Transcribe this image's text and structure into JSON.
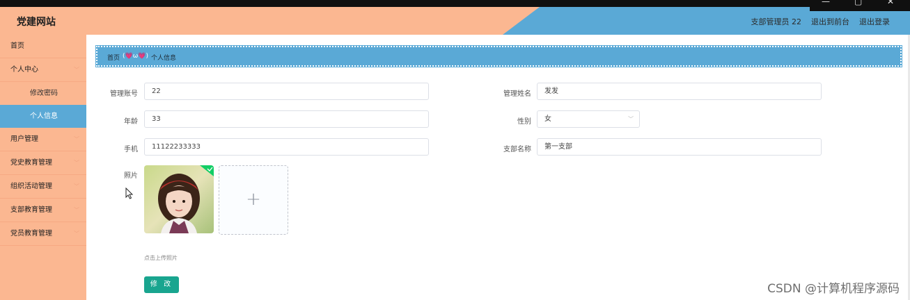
{
  "window": {
    "controls": [
      "—",
      "▢",
      "✕"
    ]
  },
  "header": {
    "brand": "党建网站",
    "role": "支部管理员 22",
    "front_link": "退出到前台",
    "logout_link": "退出登录",
    "colors": {
      "left": "#fbb791",
      "right": "#5aa9d6"
    }
  },
  "sidebar": {
    "items": [
      {
        "label": "首页"
      },
      {
        "label": "个人中心",
        "expandable": true
      },
      {
        "label": "用户管理",
        "expandable": true
      },
      {
        "label": "党史教育管理",
        "expandable": true
      },
      {
        "label": "组织活动管理",
        "expandable": true
      },
      {
        "label": "支部教育管理",
        "expandable": true
      },
      {
        "label": "党员教育管理",
        "expandable": true
      }
    ],
    "sub_items": [
      {
        "label": "修改密码"
      },
      {
        "label": "个人信息",
        "active": true
      }
    ]
  },
  "breadcrumb": {
    "home": "首页",
    "separator": "(💗ω💗)",
    "current": "个人信息"
  },
  "form": {
    "account_label": "管理账号",
    "account_value": "22",
    "name_label": "管理姓名",
    "name_value": "发发",
    "age_label": "年龄",
    "age_value": "33",
    "gender_label": "性别",
    "gender_value": "女",
    "phone_label": "手机",
    "phone_value": "11122233333",
    "branch_label": "支部名称",
    "branch_value": "第一支部",
    "photo_label": "照片",
    "upload_hint": "点击上传照片",
    "submit_label": "修 改"
  },
  "watermark": "CSDN @计算机程序源码"
}
